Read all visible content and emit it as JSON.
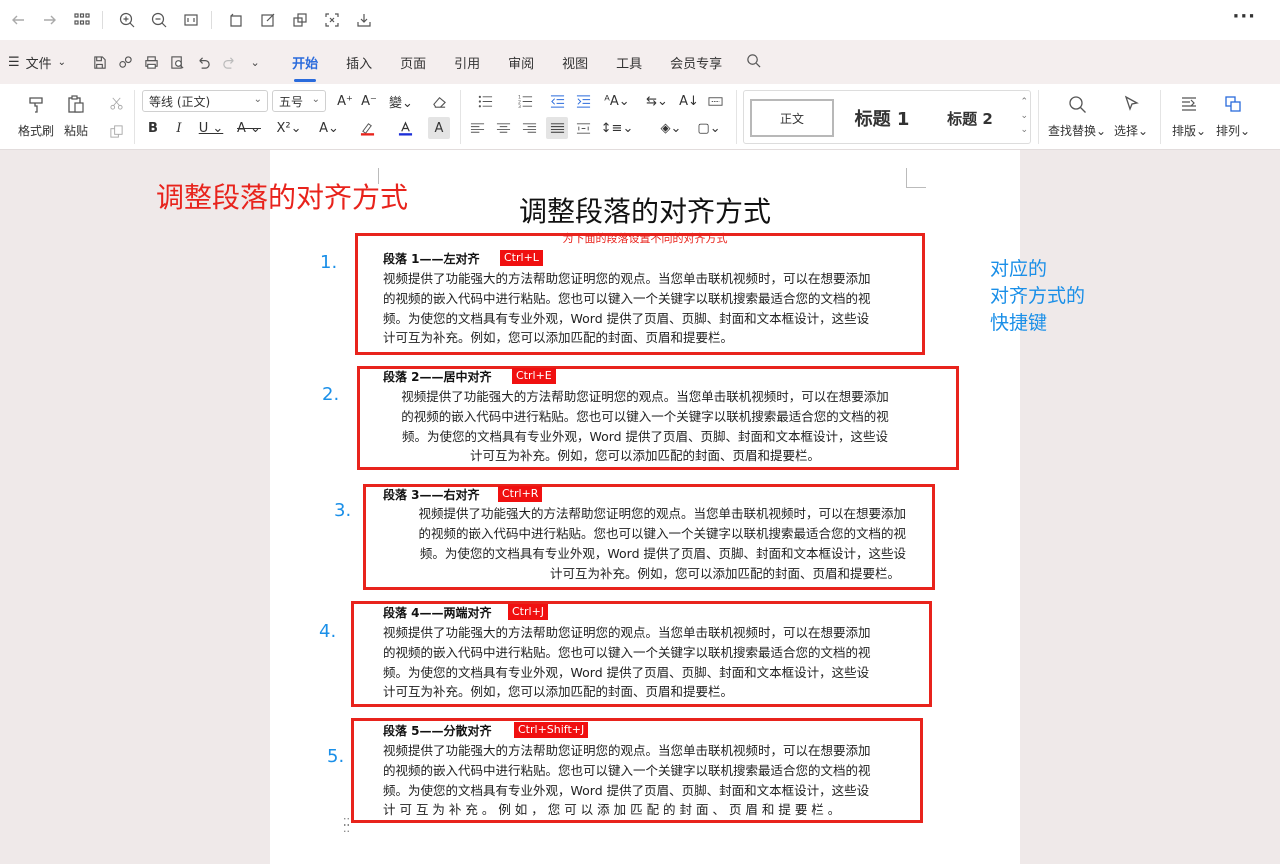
{
  "toolbar": {
    "back_icon": "arrow-left-icon",
    "forward_icon": "arrow-right-icon",
    "more_label": "···"
  },
  "ribbon_tabs": {
    "menu_label": "文件",
    "tabs": [
      "开始",
      "插入",
      "页面",
      "引用",
      "审阅",
      "视图",
      "工具",
      "会员专享"
    ],
    "active": "开始"
  },
  "ribbon": {
    "format_painter": "格式刷",
    "paste": "粘贴",
    "font_name": "等线 (正文)",
    "font_size": "五号",
    "styles": {
      "normal": "正文",
      "h1": "标题 1",
      "h2": "标题 2"
    },
    "find_replace": "查找替换",
    "select": "选择",
    "layout": "排版",
    "arrange": "排列"
  },
  "document": {
    "annotation_title": "调整段落的对齐方式",
    "title": "调整段落的对齐方式",
    "subtitle": "为下面的段落设置不同的对齐方式",
    "side_note": [
      "对应的",
      "对齐方式的",
      "快捷键"
    ],
    "paragraphs": [
      {
        "number": "1.",
        "heading": "段落 1——左对齐",
        "shortcut": "Ctrl+L",
        "lines": [
          "视频提供了功能强大的方法帮助您证明您的观点。当您单击联机视频时，可以在想要添加",
          "的视频的嵌入代码中进行粘贴。您也可以键入一个关键字以联机搜索最适合您的文档的视",
          "频。为使您的文档具有专业外观，Word 提供了页眉、页脚、封面和文本框设计，这些设",
          "计可互为补充。例如，您可以添加匹配的封面、页眉和提要栏。"
        ]
      },
      {
        "number": "2.",
        "heading": "段落 2——居中对齐",
        "shortcut": "Ctrl+E",
        "lines": [
          "视频提供了功能强大的方法帮助您证明您的观点。当您单击联机视频时，可以在想要添加",
          "的视频的嵌入代码中进行粘贴。您也可以键入一个关键字以联机搜索最适合您的文档的视",
          "频。为使您的文档具有专业外观，Word 提供了页眉、页脚、封面和文本框设计，这些设",
          "计可互为补充。例如，您可以添加匹配的封面、页眉和提要栏。"
        ]
      },
      {
        "number": "3.",
        "heading": "段落 3——右对齐",
        "shortcut": "Ctrl+R",
        "lines": [
          "视频提供了功能强大的方法帮助您证明您的观点。当您单击联机视频时，可以在想要添加",
          "的视频的嵌入代码中进行粘贴。您也可以键入一个关键字以联机搜索最适合您的文档的视",
          "频。为使您的文档具有专业外观，Word 提供了页眉、页脚、封面和文本框设计，这些设",
          "计可互为补充。例如，您可以添加匹配的封面、页眉和提要栏。"
        ]
      },
      {
        "number": "4.",
        "heading": "段落 4——两端对齐",
        "shortcut": "Ctrl+J",
        "lines": [
          "视频提供了功能强大的方法帮助您证明您的观点。当您单击联机视频时，可以在想要添加",
          "的视频的嵌入代码中进行粘贴。您也可以键入一个关键字以联机搜索最适合您的文档的视",
          "频。为使您的文档具有专业外观，Word 提供了页眉、页脚、封面和文本框设计，这些设",
          "计可互为补充。例如，您可以添加匹配的封面、页眉和提要栏。"
        ]
      },
      {
        "number": "5.",
        "heading": "段落 5——分散对齐",
        "shortcut": "Ctrl+Shift+J",
        "lines": [
          "视频提供了功能强大的方法帮助您证明您的观点。当您单击联机视频时，可以在想要添加",
          "的视频的嵌入代码中进行粘贴。您也可以键入一个关键字以联机搜索最适合您的文档的视",
          "频。为使您的文档具有专业外观，Word 提供了页眉、页脚、封面和文本框设计，这些设",
          "计 可 互 为 补 充 。 例 如 ， 您 可 以 添 加 匹 配 的 封 面 、 页 眉 和 提 要 栏 。"
        ]
      }
    ]
  },
  "colors": {
    "accent": "#2a6bdc",
    "highlight_red": "#e8231c",
    "note_blue": "#1a8fe8"
  }
}
